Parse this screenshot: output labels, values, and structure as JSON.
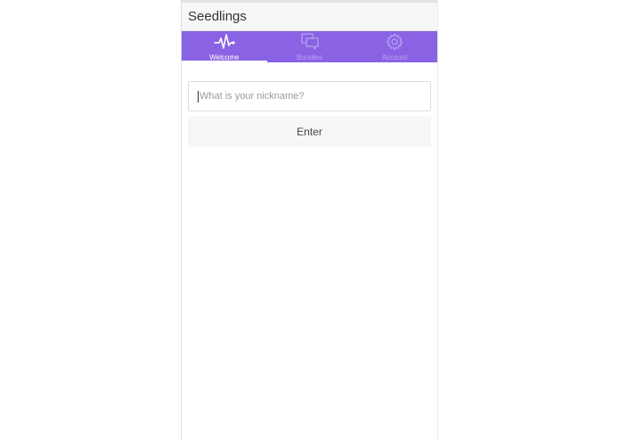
{
  "header": {
    "title": "Seedlings"
  },
  "tabs": [
    {
      "label": "Welcome",
      "icon": "pulse-icon",
      "active": true
    },
    {
      "label": "Bundles",
      "icon": "chat-bubbles-icon",
      "active": false
    },
    {
      "label": "Account",
      "icon": "gear-icon",
      "active": false
    }
  ],
  "form": {
    "nickname_placeholder": "What is your nickname?",
    "nickname_value": "",
    "enter_label": "Enter"
  },
  "colors": {
    "tab_bar": "#8a63e4",
    "tab_active_text": "#ffffff",
    "tab_inactive_text": "#b8a4ef"
  }
}
